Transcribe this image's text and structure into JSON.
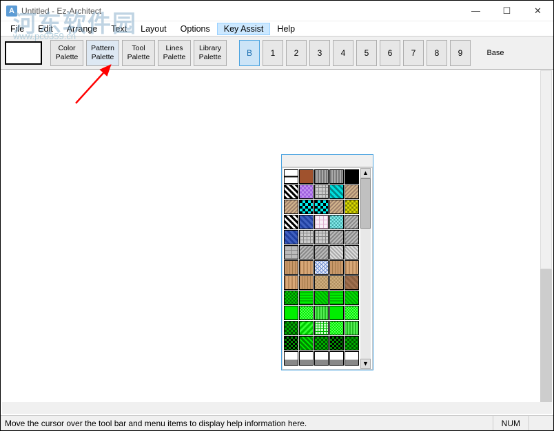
{
  "window": {
    "title": "Untitled - Ez-Architect",
    "app_icon_letter": "A",
    "controls": {
      "min": "—",
      "max": "☐",
      "close": "✕"
    }
  },
  "menubar": {
    "items": [
      "File",
      "Edit",
      "Arrange",
      "Text",
      "Layout",
      "Options",
      "Key Assist",
      "Help"
    ],
    "active_index": 6
  },
  "toolbar": {
    "palette_buttons": [
      {
        "line1": "Color",
        "line2": "Palette"
      },
      {
        "line1": "Pattern",
        "line2": "Palette"
      },
      {
        "line1": "Tool",
        "line2": "Palette"
      },
      {
        "line1": "Lines",
        "line2": "Palette"
      },
      {
        "line1": "Library",
        "line2": "Palette"
      }
    ],
    "selected_palette": 1,
    "layer_buttons": [
      "B",
      "1",
      "2",
      "3",
      "4",
      "5",
      "6",
      "7",
      "8",
      "9"
    ],
    "selected_layer": 0,
    "base_label": "Base"
  },
  "pattern_palette": {
    "scroll_up": "▲",
    "scroll_down": "▼",
    "rows": [
      [
        "p-line",
        "p-brown",
        "p-vstripe",
        "p-vstripe",
        "p-black"
      ],
      [
        "p-diag-bw",
        "p-purple-chk",
        "p-cross-gray",
        "p-cyan-diag",
        "p-tan-wave"
      ],
      [
        "p-tan-wave",
        "p-cyan-chk",
        "p-cyan-chk",
        "p-tan-wave",
        "p-yellow-chk"
      ],
      [
        "p-diag-bw",
        "p-blue-weave",
        "p-pink-grid",
        "p-cyan-chk2",
        "p-gray-zig"
      ],
      [
        "p-blue-weave",
        "p-cross-gray",
        "p-cross-gray",
        "p-gray-zig",
        "p-gray-zig"
      ],
      [
        "p-brick",
        "p-gray-zig",
        "p-gray-zig",
        "p-gray-diag",
        "p-gray-diag"
      ],
      [
        "p-wood1",
        "p-wood2",
        "p-blue-hatch",
        "p-wood1",
        "p-wood2"
      ],
      [
        "p-wood2",
        "p-wood1",
        "p-tan-chk",
        "p-tan-chk",
        "p-brown-diag"
      ],
      [
        "p-green1",
        "p-green2",
        "p-green3",
        "p-green2",
        "p-green3"
      ],
      [
        "p-green4",
        "p-green5",
        "p-green6",
        "p-green4",
        "p-green5"
      ],
      [
        "p-green7",
        "p-green8",
        "p-green9",
        "p-green5",
        "p-green6"
      ],
      [
        "p-green10",
        "p-green11",
        "p-green7",
        "p-green10",
        "p-green7"
      ],
      [
        "p-partial",
        "p-partial",
        "p-partial",
        "p-partial",
        "p-partial"
      ]
    ]
  },
  "statusbar": {
    "help_text": "Move the cursor over the tool bar and menu items to display help information here.",
    "indicator": "NUM"
  },
  "watermark": {
    "main": "河东软件园",
    "sub": "www.pc0359.cn"
  }
}
